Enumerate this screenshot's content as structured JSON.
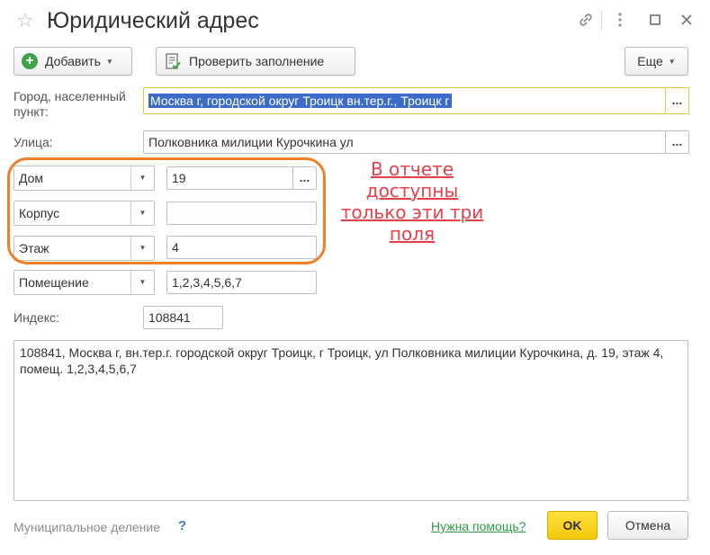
{
  "window": {
    "title": "Юридический адрес",
    "icons": [
      "star-icon",
      "link-icon",
      "more-icon",
      "maximize-icon",
      "close-icon"
    ]
  },
  "toolbar": {
    "add_label": "Добавить",
    "check_label": "Проверить заполнение",
    "more_label": "Еще"
  },
  "fields": {
    "city_label": "Город, населенный пункт:",
    "city_value": "Москва г, городской округ Троицк вн.тер.г., Троицк г",
    "street_label": "Улица:",
    "street_value": "Полковника милиции Курочкина ул",
    "ellipsis": "...",
    "house_type": "Дом",
    "house_value": "19",
    "building_type": "Корпус",
    "building_value": "",
    "floor_type": "Этаж",
    "floor_value": "4",
    "room_type": "Помещение",
    "room_value": "1,2,3,4,5,6,7",
    "index_label": "Индекс:",
    "index_value": "108841"
  },
  "full_address": "108841, Москва г, вн.тер.г. городской округ Троицк, г Троицк, ул Полковника милиции Курочкина, д. 19, этаж 4, помещ. 1,2,3,4,5,6,7",
  "annotation": {
    "lines": [
      "В отчете",
      "доступны",
      "только эти три",
      "поля"
    ],
    "color": "#e8404a",
    "frame_color": "#f07f25"
  },
  "footer": {
    "municipal_label": "Муниципальное деление",
    "question_mark": "?",
    "help_link": "Нужна помощь?",
    "ok_label": "OK",
    "cancel_label": "Отмена"
  },
  "colors": {
    "ok_button": "#f4c90c",
    "selection": "#3d6bc9",
    "help_link": "#2e9a45",
    "add_icon": "#3ea34a"
  }
}
